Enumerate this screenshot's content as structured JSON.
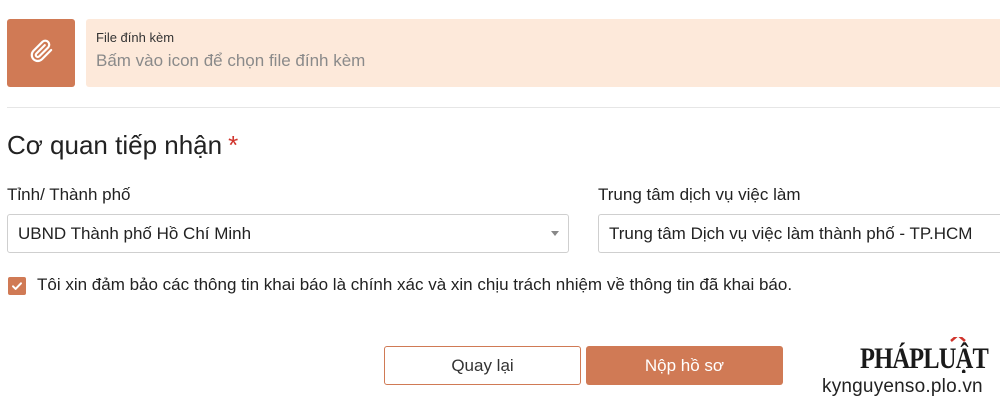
{
  "attachment": {
    "title": "File đính kèm",
    "hint": "Bấm vào icon để chọn file đính kèm",
    "icon": "paperclip-icon"
  },
  "section": {
    "title": "Cơ quan tiếp nhận",
    "required_mark": "*"
  },
  "province": {
    "label": "Tỉnh/ Thành phố",
    "selected": "UBND Thành phố Hồ Chí Minh"
  },
  "center": {
    "label": "Trung tâm dịch vụ việc làm",
    "selected": "Trung tâm Dịch vụ việc làm thành phố - TP.HCM"
  },
  "agreement": {
    "checked": true,
    "text": "Tôi xin đảm bảo các thông tin khai báo là chính xác và xin chịu trách nhiệm về thông tin đã khai báo."
  },
  "actions": {
    "back_label": "Quay lại",
    "submit_label": "Nộp hồ sơ"
  },
  "watermark": {
    "logo_text": "PHÁPLUẬT",
    "url": "kynguyenso.plo.vn"
  },
  "colors": {
    "accent": "#d07a55",
    "attach_bg": "#fde9da",
    "required": "#d0342c"
  }
}
